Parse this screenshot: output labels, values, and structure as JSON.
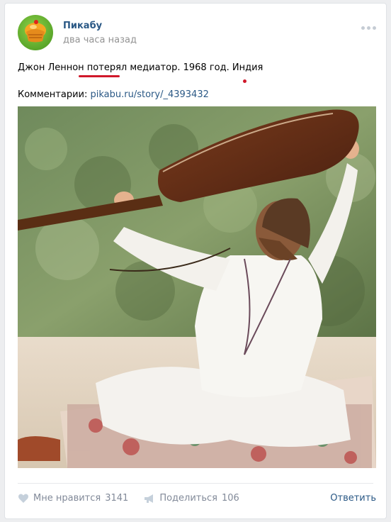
{
  "post": {
    "author": "Пикабу",
    "time": "два часа назад",
    "text": "Джон Леннон потерял медиатор. 1968 год. Индия",
    "comments_label": "Комментарии: ",
    "comments_link": "pikabu.ru/story/_4393432"
  },
  "actions": {
    "like_label": "Мне нравится",
    "like_count": "3141",
    "share_label": "Поделиться",
    "share_count": "106",
    "reply_label": "Ответить"
  },
  "colors": {
    "link": "#2a5885",
    "muted": "#828a99",
    "annotation": "#d0182a"
  }
}
